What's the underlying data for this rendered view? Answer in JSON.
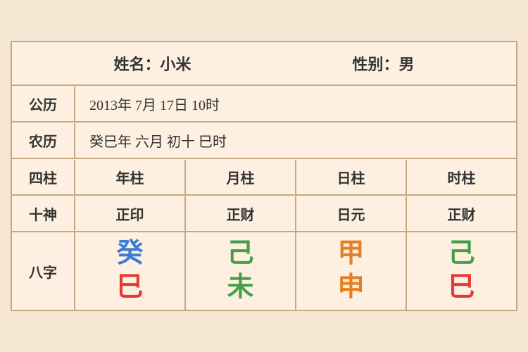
{
  "header": {
    "name_label": "姓名：小米",
    "gender_label": "性别：男"
  },
  "solar": {
    "label": "公历",
    "content": "2013年 7月 17日 10时"
  },
  "lunar": {
    "label": "农历",
    "content": "癸巳年 六月 初十 巳时"
  },
  "sizu": {
    "label": "四柱",
    "cols": [
      "年柱",
      "月柱",
      "日柱",
      "时柱"
    ]
  },
  "shishen": {
    "label": "十神",
    "cols": [
      "正印",
      "正财",
      "日元",
      "正财"
    ]
  },
  "bazi": {
    "label": "八字",
    "cols": [
      {
        "top": "癸",
        "top_color": "color-blue",
        "bottom": "巳",
        "bottom_color": "color-red"
      },
      {
        "top": "己",
        "top_color": "color-green",
        "bottom": "未",
        "bottom_color": "color-green"
      },
      {
        "top": "甲",
        "top_color": "color-orange",
        "bottom": "申",
        "bottom_color": "color-orange"
      },
      {
        "top": "己",
        "top_color": "color-green",
        "bottom": "巳",
        "bottom_color": "color-red"
      }
    ]
  }
}
